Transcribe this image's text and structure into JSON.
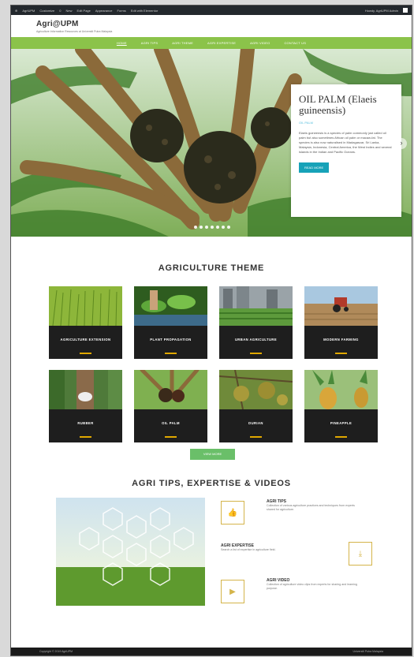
{
  "adminbar": {
    "items": [
      "AgriUPM",
      "Customize",
      "0",
      "New",
      "Edit Page",
      "Appearance",
      "Forms",
      "Edit with Elementor"
    ],
    "user": "Howdy, AgriUPM Admin"
  },
  "header": {
    "logo": "Agri@UPM",
    "tagline": "Agriculture Information Resources at Universiti Putra Malaysia"
  },
  "nav": {
    "items": [
      "HOME",
      "AGRI TIPS",
      "AGRI THEME",
      "AGRI EXPERTISE",
      "AGRI VIDEO",
      "CONTACT US"
    ]
  },
  "hero": {
    "title": "OIL PALM (Elaeis guineensis)",
    "subtitle": "OIL PALM",
    "text": "Elaeis guineensis is a species of palm commonly just called oil palm but also sometimes African oil palm or macaw-fat. The species is also now naturalised in Madagascar, Sri Lanka, Malaysia, Indonesia, Central America, the West Indies and several islands in the Indian and Pacific Oceans.",
    "button": "READ MORE",
    "prev": "‹",
    "next": "›"
  },
  "theme": {
    "title": "AGRICULTURE THEME",
    "cards": [
      {
        "label": "AGRICULTURE EXTENSION"
      },
      {
        "label": "PLANT PROPAGATION"
      },
      {
        "label": "URBAN AGRICULTURE"
      },
      {
        "label": "MODERN FARMING"
      },
      {
        "label": "RUBBER"
      },
      {
        "label": "OIL PALM"
      },
      {
        "label": "DURIAN"
      },
      {
        "label": "PINEAPPLE"
      }
    ],
    "more_button": "VIEW MORE"
  },
  "tips": {
    "title": "AGRI TIPS, EXPERTISE & VIDEOS",
    "items": [
      {
        "heading": "AGRI TIPS",
        "text": "Collection of various agriculture practices and techniques from experts shared for agriculture."
      },
      {
        "heading": "AGRI EXPERTISE",
        "text": "Search a list of expertise in agriculture field."
      },
      {
        "heading": "AGRI VIDEO",
        "text": "Collection of agriculture video clips from experts for sharing and learning purpose."
      }
    ]
  },
  "footer": {
    "left": "Copyright © 2019 AgriUPM",
    "right": "Universiti Putra Malaysia"
  },
  "colors": {
    "nav_green": "#8bc34a",
    "button_teal": "#17a2b8",
    "accent_gold": "#e0a800",
    "card_dark": "#1e1e1e",
    "view_more_green": "#6abf69"
  }
}
